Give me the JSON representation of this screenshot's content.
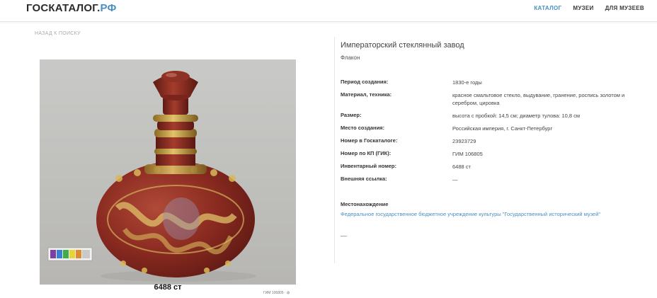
{
  "header": {
    "logo_main": "ГОСКАТАЛОГ.",
    "logo_suffix": "РФ",
    "nav": [
      {
        "label": "КАТАЛОГ",
        "active": true
      },
      {
        "label": "МУЗЕИ",
        "active": false
      },
      {
        "label": "ДЛЯ МУЗЕЕВ",
        "active": false
      }
    ]
  },
  "back_link": "НАЗАД К ПОИСКУ",
  "photo": {
    "caption": "6488 ст",
    "small_note": "ГИМ 106805 · ф"
  },
  "item": {
    "title": "Императорский стеклянный завод",
    "subtitle": "Флакон"
  },
  "properties": [
    {
      "key": "Период создания:",
      "value": "1830-е годы"
    },
    {
      "key": "Материал, техника:",
      "value": "красное смальтовое стекло, выдувание, гранение, роспись золотом и серебром, цировка"
    },
    {
      "key": "Размер:",
      "value": "высота с пробкой: 14,5 см; диаметр тулова: 10,8 см"
    },
    {
      "key": "Место создания:",
      "value": "Российская империя, г. Санкт-Петербург"
    },
    {
      "key": "Номер в Госкаталоге:",
      "value": "23923729"
    },
    {
      "key": "Номер по КП (ГИК):",
      "value": "ГИМ 106805"
    },
    {
      "key": "Инвентарный номер:",
      "value": "6488 ст"
    },
    {
      "key": "Внешняя ссылка:",
      "value": "—"
    }
  ],
  "location": {
    "label": "Местонахождение",
    "museum": "Федеральное государственное бюджетное учреждение культуры \"Государственный исторический музей\""
  },
  "footer_dash": "—",
  "colors": {
    "accent": "#4a8fc0",
    "glass_red": "#8e2a22",
    "gold": "#c9a543"
  }
}
